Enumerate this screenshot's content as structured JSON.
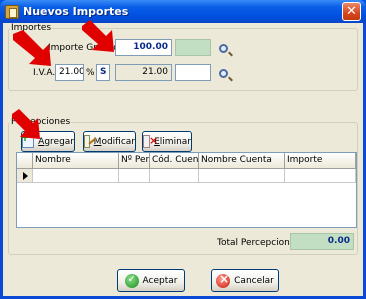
{
  "window": {
    "title": "Nuevos Importes",
    "close_symbol": "✕"
  },
  "importes": {
    "legend": "Importes",
    "gravado_label": "Importe Gravado:",
    "gravado_value": "100.00",
    "gravado_extra": "",
    "iva_label": "I.V.A.:",
    "iva_rate": "21.00",
    "percent_symbol": "%",
    "iva_code": "S",
    "iva_amount": "21.00",
    "iva_extra": ""
  },
  "percepciones": {
    "legend": "Percepciones",
    "add_label": "gregar",
    "add_accel": "A",
    "edit_label": "odificar",
    "edit_accel": "M",
    "delete_label": "liminar",
    "delete_accel": "E",
    "columns": [
      "Nombre",
      "Nº Per.",
      "Cód. Cuenta",
      "Nombre Cuenta",
      "Importe"
    ],
    "rows": [
      [
        "",
        "",
        "",
        "",
        ""
      ]
    ],
    "total_label": "Total Percepciones:",
    "total_value": "0.00"
  },
  "footer": {
    "accept_label": "Aceptar",
    "cancel_label": "Cancelar"
  },
  "colors": {
    "title_bar": "#0050e0",
    "window_bg": "#ece9d8",
    "annotation_arrow": "#e00000"
  }
}
